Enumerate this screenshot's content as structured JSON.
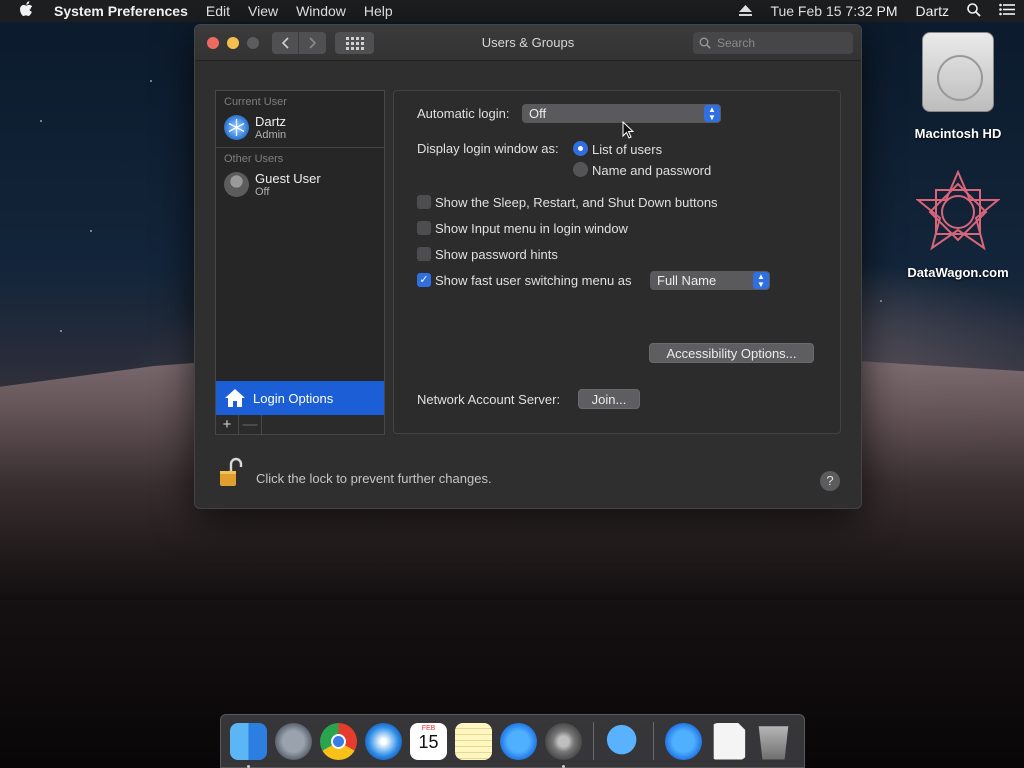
{
  "menubar": {
    "app_name": "System Preferences",
    "menus": [
      "Edit",
      "View",
      "Window",
      "Help"
    ],
    "datetime": "Tue Feb 15  7:32 PM",
    "user": "Dartz"
  },
  "window": {
    "title": "Users & Groups",
    "search_placeholder": "Search"
  },
  "sidebar": {
    "current_user_label": "Current User",
    "current_user": {
      "name": "Dartz",
      "role": "Admin"
    },
    "other_users_label": "Other Users",
    "other_users": [
      {
        "name": "Guest User",
        "status": "Off"
      }
    ],
    "login_options_label": "Login Options",
    "add_symbol": "+",
    "remove_symbol": "—"
  },
  "login_options": {
    "automatic_login_label": "Automatic login:",
    "automatic_login_value": "Off",
    "display_login_label": "Display login window as:",
    "radio_list_of_users": "List of users",
    "radio_name_and_password": "Name and password",
    "selected_display": "List of users",
    "checkboxes": [
      {
        "label": "Show the Sleep, Restart, and Shut Down buttons",
        "checked": false
      },
      {
        "label": "Show Input menu in login window",
        "checked": false
      },
      {
        "label": "Show password hints",
        "checked": false
      },
      {
        "label": "Show fast user switching menu as",
        "checked": true
      }
    ],
    "fast_user_switching_value": "Full Name",
    "accessibility_button": "Accessibility Options...",
    "network_server_label": "Network Account Server:",
    "join_button": "Join..."
  },
  "footer": {
    "lock_message": "Click the lock to prevent further changes.",
    "help_symbol": "?"
  },
  "desktop": {
    "icons": [
      {
        "label": "Macintosh HD",
        "icon": "hard-drive-icon"
      },
      {
        "label": "DataWagon.com",
        "icon": "datawagon-logo-icon"
      }
    ]
  },
  "dock": {
    "apps": [
      "finder-icon",
      "launchpad-icon",
      "chrome-icon",
      "safari-icon",
      "calendar-icon",
      "notes-icon",
      "app-store-icon",
      "system-preferences-icon",
      "messages-icon",
      "app-store-download-icon",
      "document-icon",
      "trash-icon"
    ],
    "calendar_month": "FEB",
    "calendar_day": "15"
  },
  "colors": {
    "accent": "#2f6fe0",
    "selection": "#1b5ed6"
  }
}
